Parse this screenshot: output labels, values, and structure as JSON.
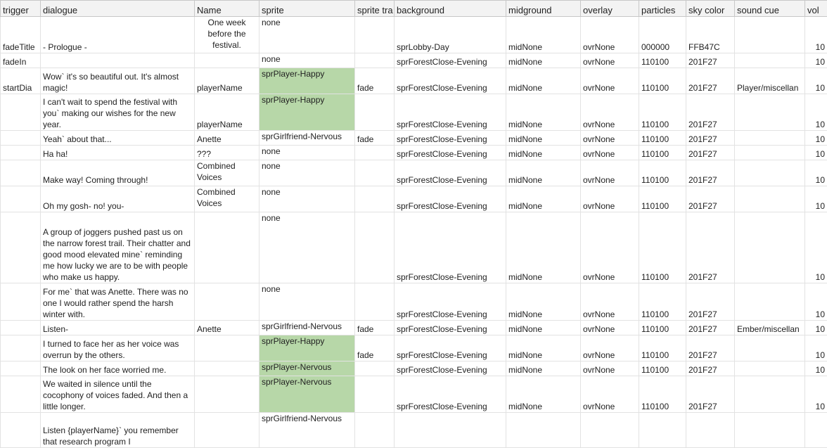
{
  "headers": [
    "trigger",
    "dialogue",
    "Name",
    "sprite",
    "sprite tra",
    "background",
    "midground",
    "overlay",
    "particles",
    "sky color",
    "sound cue",
    "vol"
  ],
  "highlight_color": "#b7d7a8",
  "rows": [
    {
      "trigger": "fadeTitle",
      "dialogue": "- Prologue -",
      "name": "One week before the festival.",
      "sprite": "none",
      "transition": "",
      "background": "sprLobby-Day",
      "midground": "midNone",
      "overlay": "ovrNone",
      "particles": "000000",
      "sky": "FFB47C",
      "sound": "",
      "vol": "10",
      "h": 52,
      "sprite_green": false
    },
    {
      "trigger": "fadeIn",
      "dialogue": "",
      "name": "",
      "sprite": "none",
      "transition": "",
      "background": "sprForestClose-Evening",
      "midground": "midNone",
      "overlay": "ovrNone",
      "particles": "110100",
      "sky": "201F27",
      "sound": "",
      "vol": "10",
      "h": 21,
      "sprite_green": false
    },
    {
      "trigger": "startDia",
      "dialogue": "Wow` it's so beautiful out. It's almost magic!",
      "name": "playerName",
      "sprite": "sprPlayer-Happy",
      "transition": "fade",
      "background": "sprForestClose-Evening",
      "midground": "midNone",
      "overlay": "ovrNone",
      "particles": "110100",
      "sky": "201F27",
      "sound": "Player/miscellan",
      "vol": "10",
      "h": 37,
      "sprite_green": true
    },
    {
      "trigger": "",
      "dialogue": "I can't wait to spend the festival with you` making our wishes for the new year.",
      "name": "playerName",
      "sprite": "sprPlayer-Happy",
      "transition": "",
      "background": "sprForestClose-Evening",
      "midground": "midNone",
      "overlay": "ovrNone",
      "particles": "110100",
      "sky": "201F27",
      "sound": "",
      "vol": "10",
      "h": 52,
      "sprite_green": true
    },
    {
      "trigger": "",
      "dialogue": "Yeah` about that...",
      "name": "Anette",
      "sprite": "sprGirlfriend-Nervous",
      "transition": "fade",
      "background": "sprForestClose-Evening",
      "midground": "midNone",
      "overlay": "ovrNone",
      "particles": "110100",
      "sky": "201F27",
      "sound": "",
      "vol": "10",
      "h": 21,
      "sprite_green": false
    },
    {
      "trigger": "",
      "dialogue": "Ha ha!",
      "name": "???",
      "sprite": "none",
      "transition": "",
      "background": "sprForestClose-Evening",
      "midground": "midNone",
      "overlay": "ovrNone",
      "particles": "110100",
      "sky": "201F27",
      "sound": "",
      "vol": "10",
      "h": 21,
      "sprite_green": false
    },
    {
      "trigger": "",
      "dialogue": "Make way! Coming through!",
      "name": "Combined Voices",
      "sprite": "none",
      "transition": "",
      "background": "sprForestClose-Evening",
      "midground": "midNone",
      "overlay": "ovrNone",
      "particles": "110100",
      "sky": "201F27",
      "sound": "",
      "vol": "10",
      "h": 37,
      "sprite_green": false
    },
    {
      "trigger": "",
      "dialogue": "Oh my gosh- no! you-",
      "name": "Combined Voices",
      "sprite": "none",
      "transition": "",
      "background": "sprForestClose-Evening",
      "midground": "midNone",
      "overlay": "ovrNone",
      "particles": "110100",
      "sky": "201F27",
      "sound": "",
      "vol": "10",
      "h": 37,
      "sprite_green": false
    },
    {
      "trigger": "",
      "dialogue": "A group of joggers pushed past us on the narrow forest trail. Their chatter and good mood elevated mine` reminding me how lucky we are to be with people who make us happy.",
      "name": "",
      "sprite": "none",
      "transition": "",
      "background": "sprForestClose-Evening",
      "midground": "midNone",
      "overlay": "ovrNone",
      "particles": "110100",
      "sky": "201F27",
      "sound": "",
      "vol": "10",
      "h": 101,
      "sprite_green": false
    },
    {
      "trigger": "",
      "dialogue": "For me` that was Anette. There was no one I would rather spend the harsh winter with.",
      "name": "",
      "sprite": "none",
      "transition": "",
      "background": "sprForestClose-Evening",
      "midground": "midNone",
      "overlay": "ovrNone",
      "particles": "110100",
      "sky": "201F27",
      "sound": "",
      "vol": "10",
      "h": 53,
      "sprite_green": false
    },
    {
      "trigger": "",
      "dialogue": "Listen-",
      "name": "Anette",
      "sprite": "sprGirlfriend-Nervous",
      "transition": "fade",
      "background": "sprForestClose-Evening",
      "midground": "midNone",
      "overlay": "ovrNone",
      "particles": "110100",
      "sky": "201F27",
      "sound": "Ember/miscellan",
      "vol": "10",
      "h": 21,
      "sprite_green": false
    },
    {
      "trigger": "",
      "dialogue": "I turned to face her as her voice was overrun by the others.",
      "name": "",
      "sprite": "sprPlayer-Happy",
      "transition": "fade",
      "background": "sprForestClose-Evening",
      "midground": "midNone",
      "overlay": "ovrNone",
      "particles": "110100",
      "sky": "201F27",
      "sound": "",
      "vol": "10",
      "h": 37,
      "sprite_green": true
    },
    {
      "trigger": "",
      "dialogue": "The look on her face worried me.",
      "name": "",
      "sprite": "sprPlayer-Nervous",
      "transition": "",
      "background": "sprForestClose-Evening",
      "midground": "midNone",
      "overlay": "ovrNone",
      "particles": "110100",
      "sky": "201F27",
      "sound": "",
      "vol": "10",
      "h": 21,
      "sprite_green": true
    },
    {
      "trigger": "",
      "dialogue": "We waited in silence until the cocophony of voices faded. And then a little longer.",
      "name": "",
      "sprite": "sprPlayer-Nervous",
      "transition": "",
      "background": "sprForestClose-Evening",
      "midground": "midNone",
      "overlay": "ovrNone",
      "particles": "110100",
      "sky": "201F27",
      "sound": "",
      "vol": "10",
      "h": 52,
      "sprite_green": true
    },
    {
      "trigger": "",
      "dialogue": "Listen {playerName}` you remember that research program I",
      "name": "",
      "sprite": "sprGirlfriend-Nervous",
      "transition": "",
      "background": "",
      "midground": "",
      "overlay": "",
      "particles": "",
      "sky": "",
      "sound": "",
      "vol": "",
      "h": 50,
      "sprite_green": false
    }
  ]
}
